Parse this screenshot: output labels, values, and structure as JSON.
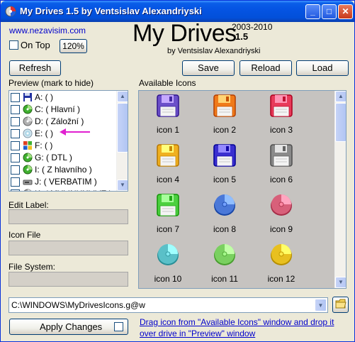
{
  "window": {
    "title": "My Drives 1.5 by Ventsislav Alexandriyski",
    "minimize": "_",
    "maximize": "□",
    "close": "✕"
  },
  "header": {
    "website": "www.nezavisim.com",
    "on_top_label": "On Top",
    "on_top_checked": false,
    "zoom": "120%",
    "app_name": "My Drives",
    "years": "2003-2010",
    "version": "1.5",
    "author": "by Ventsislav Alexandriyski"
  },
  "buttons": {
    "refresh": "Refresh",
    "save": "Save",
    "reload": "Reload",
    "load": "Load",
    "apply": "Apply Changes"
  },
  "preview": {
    "label": "Preview (mark to hide)",
    "drives": [
      {
        "text": "A:  ( )",
        "icon": "floppy-drive-icon"
      },
      {
        "text": "C:  ( Hlavní )",
        "icon": "green-disk-icon"
      },
      {
        "text": "D:  ( Záložní )",
        "icon": "grey-disk-icon"
      },
      {
        "text": "E:  ( )",
        "icon": "cd-drive-icon"
      },
      {
        "text": "F:  ( )",
        "icon": "windows-drive-icon"
      },
      {
        "text": "G:  ( DTL )",
        "icon": "green-disk-icon"
      },
      {
        "text": "I:  ( Z hlavního )",
        "icon": "green-disk-icon"
      },
      {
        "text": "J:  ( VERBATIM )",
        "icon": "usb-drive-icon"
      },
      {
        "text": "K:  ( MYLINUXLIVE )",
        "icon": "grey-disk-icon"
      }
    ]
  },
  "available": {
    "label": "Available Icons",
    "icons": [
      {
        "label": "icon 1",
        "kind": "floppy",
        "color": "#6B4FC9"
      },
      {
        "label": "icon 2",
        "kind": "floppy",
        "color": "#F07A1A"
      },
      {
        "label": "icon 3",
        "kind": "floppy",
        "color": "#E83A5A"
      },
      {
        "label": "icon 4",
        "kind": "floppy",
        "color": "#F0B020"
      },
      {
        "label": "icon 5",
        "kind": "floppy",
        "color": "#3A2FD0"
      },
      {
        "label": "icon 6",
        "kind": "floppy",
        "color": "#8A8A8A"
      },
      {
        "label": "icon 7",
        "kind": "floppy",
        "color": "#4CD040"
      },
      {
        "label": "icon 8",
        "kind": "disk",
        "color": "#4A78D8"
      },
      {
        "label": "icon 9",
        "kind": "disk",
        "color": "#D8607A"
      },
      {
        "label": "icon 10",
        "kind": "disk",
        "color": "#5AC0C8"
      },
      {
        "label": "icon 11",
        "kind": "disk",
        "color": "#7AD060"
      },
      {
        "label": "icon 12",
        "kind": "disk",
        "color": "#E8C020"
      }
    ]
  },
  "fields": {
    "edit_label": "Edit Label:",
    "icon_file": "Icon File",
    "file_system": "File System:"
  },
  "path": {
    "value": "C:\\WINDOWS\\MyDrivesIcons.g@w"
  },
  "hint": {
    "line1": "Drag icon from \"Available Icons\" window and drop it",
    "line2": "over drive in \"Preview\" window"
  },
  "colors": {
    "arrow": "#E020D0"
  }
}
